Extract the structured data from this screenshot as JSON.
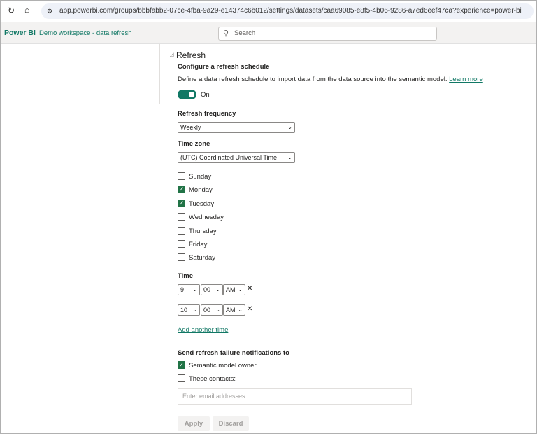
{
  "browser": {
    "url": "app.powerbi.com/groups/bbbfabb2-07ce-4fba-9a29-e14374c6b012/settings/datasets/caa69085-e8f5-4b06-9286-a7ed6eef47ca?experience=power-bi"
  },
  "header": {
    "app": "Power BI",
    "workspace": "Demo workspace - data refresh",
    "search_placeholder": "Search"
  },
  "refresh": {
    "section_title": "Refresh",
    "configure_title": "Configure a refresh schedule",
    "description": "Define a data refresh schedule to import data from the data source into the semantic model.",
    "learn_more": "Learn more",
    "toggle_label": "On",
    "toggle_on": true,
    "frequency_label": "Refresh frequency",
    "frequency": "Weekly",
    "timezone_label": "Time zone",
    "timezone": "(UTC) Coordinated Universal Time",
    "days": [
      {
        "label": "Sunday",
        "checked": false
      },
      {
        "label": "Monday",
        "checked": true
      },
      {
        "label": "Tuesday",
        "checked": true
      },
      {
        "label": "Wednesday",
        "checked": false
      },
      {
        "label": "Thursday",
        "checked": false
      },
      {
        "label": "Friday",
        "checked": false
      },
      {
        "label": "Saturday",
        "checked": false
      }
    ],
    "time_label": "Time",
    "times": [
      {
        "hour": "9",
        "minute": "00",
        "ampm": "AM"
      },
      {
        "hour": "10",
        "minute": "00",
        "ampm": "AM"
      }
    ],
    "remove_glyph": "✕",
    "add_time": "Add another time",
    "notify_label": "Send refresh failure notifications to",
    "notify_owner": {
      "label": "Semantic model owner",
      "checked": true
    },
    "notify_contacts": {
      "label": "These contacts:",
      "checked": false
    },
    "email_placeholder": "Enter email addresses",
    "apply": "Apply",
    "discard": "Discard"
  },
  "colors": {
    "accent": "#117865",
    "checkbox": "#217346"
  }
}
